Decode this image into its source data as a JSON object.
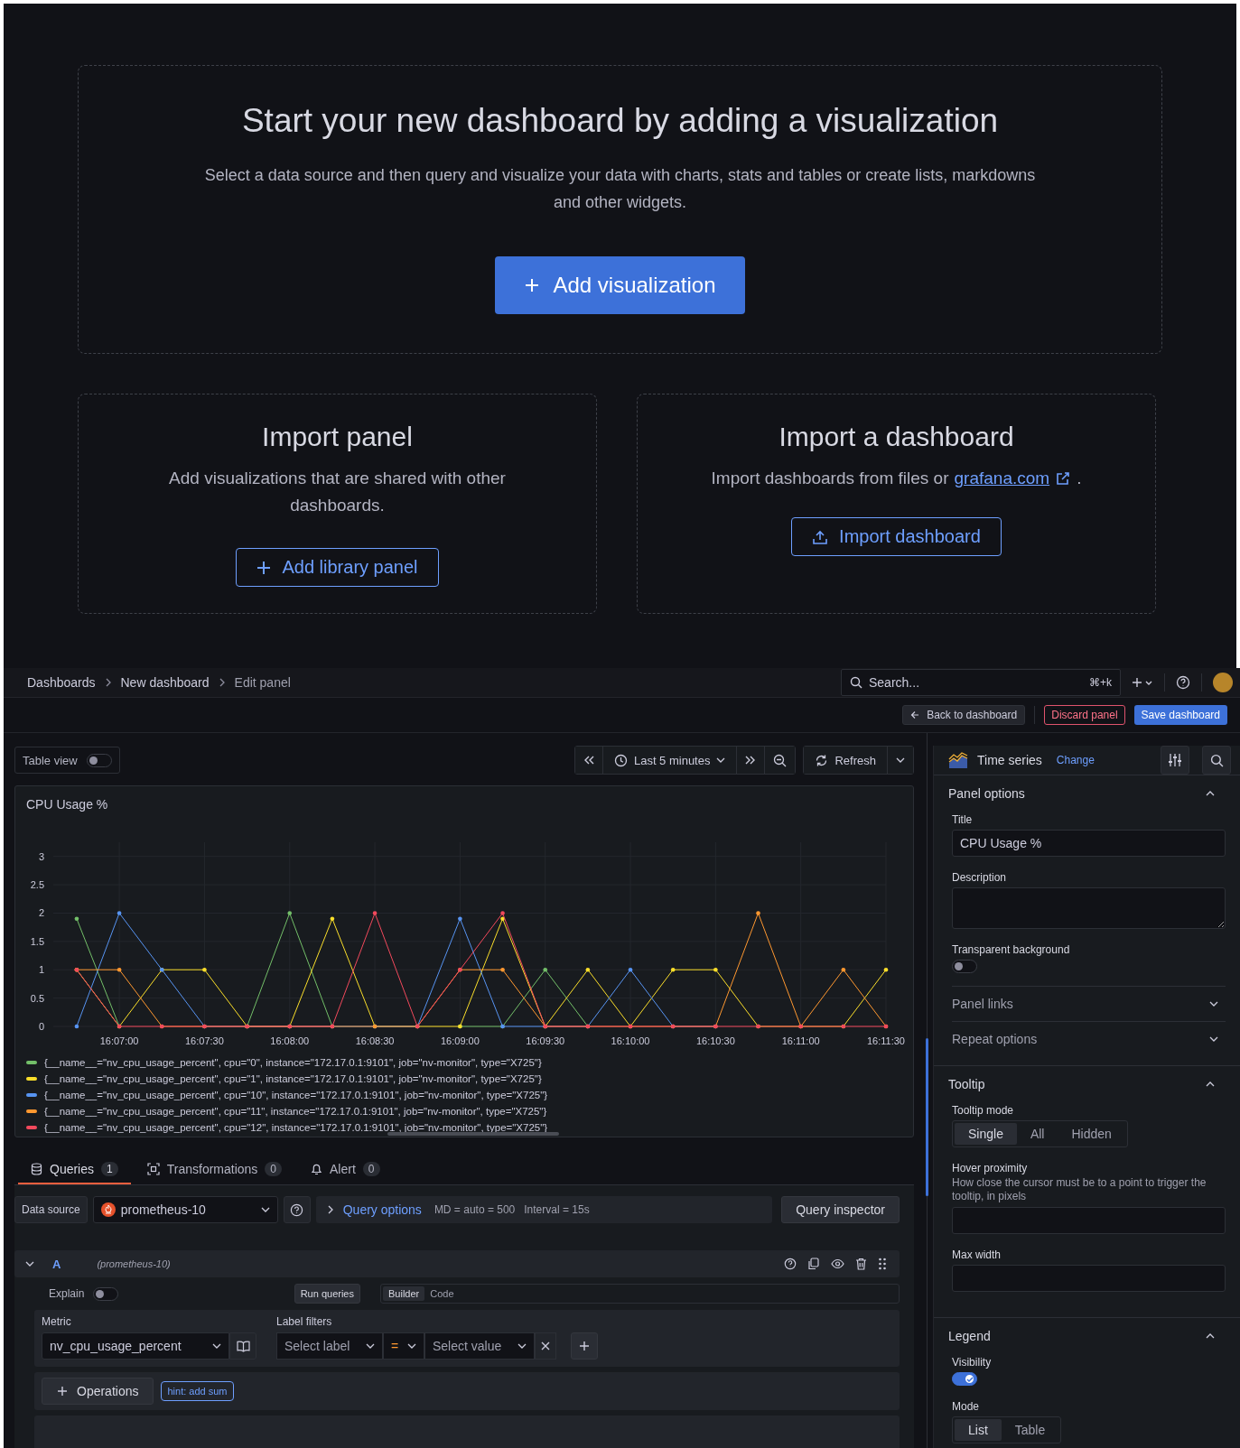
{
  "empty_state": {
    "title": "Start your new dashboard by adding a visualization",
    "description": "Select a data source and then query and visualize your data with charts, stats and tables or create lists, markdowns and other widgets.",
    "button": "Add visualization"
  },
  "import_panel": {
    "title": "Import panel",
    "description": "Add visualizations that are shared with other dashboards.",
    "button": "Add library panel"
  },
  "import_dashboard": {
    "title": "Import a dashboard",
    "description": "Import dashboards from files or",
    "link": "grafana.com",
    "description_end": ".",
    "button": "Import dashboard"
  },
  "top_bar": {
    "breadcrumbs": [
      "Dashboards",
      "New dashboard",
      "Edit panel"
    ],
    "search": {
      "placeholder": "Search...",
      "shortcut": "⌘+k"
    }
  },
  "actions": {
    "back": "Back to dashboard",
    "discard": "Discard panel",
    "save": "Save dashboard"
  },
  "panel_toolbar": {
    "table_view": {
      "label": "Table view",
      "on": false
    },
    "time_range": "Last 5 minutes",
    "refresh": "Refresh"
  },
  "panel": {
    "title": "CPU Usage %",
    "chart_data": {
      "type": "line",
      "categories": [
        null,
        "16:07:00",
        null,
        "16:07:30",
        null,
        "16:08:00",
        null,
        "16:08:30",
        null,
        "16:09:00",
        null,
        "16:09:30",
        null,
        "16:10:00",
        null,
        "16:10:30",
        null,
        "16:11:00",
        null,
        "16:11:30"
      ],
      "ylim": [
        0,
        3.25
      ],
      "grid": true,
      "yticks": [
        0,
        0.5,
        1,
        1.5,
        2,
        2.5,
        3
      ],
      "series": [
        {
          "name": "{__name__=\"nv_cpu_usage_percent\", cpu=\"0\", instance=\"172.17.0.1:9101\", job=\"nv-monitor\", type=\"X725\"}",
          "color": "#73bf69",
          "values": [
            1.9,
            0,
            null,
            null,
            0,
            2,
            0,
            null,
            null,
            0,
            0,
            1,
            0,
            null,
            null,
            null,
            null,
            null,
            null,
            null
          ]
        },
        {
          "name": "{__name__=\"nv_cpu_usage_percent\", cpu=\"1\", instance=\"172.17.0.1:9101\", job=\"nv-monitor\", type=\"X725\"}",
          "color": "#fade2a",
          "values": [
            1,
            0,
            1,
            1,
            0,
            0,
            1.9,
            0,
            0,
            0,
            1.9,
            0,
            1,
            0,
            1,
            1,
            0,
            0,
            0,
            1
          ]
        },
        {
          "name": "{__name__=\"nv_cpu_usage_percent\", cpu=\"10\", instance=\"172.17.0.1:9101\", job=\"nv-monitor\", type=\"X725\"}",
          "color": "#5794f2",
          "values": [
            0,
            2,
            1,
            0,
            0,
            0,
            0,
            0,
            0,
            1.9,
            0,
            0,
            0,
            1,
            0,
            0,
            null,
            null,
            null,
            null
          ]
        },
        {
          "name": "{__name__=\"nv_cpu_usage_percent\", cpu=\"11\", instance=\"172.17.0.1:9101\", job=\"nv-monitor\", type=\"X725\"}",
          "color": "#ff9830",
          "values": [
            1,
            1,
            0,
            0,
            0,
            0,
            0,
            0,
            0,
            1,
            1,
            0,
            0,
            0,
            0,
            0,
            2,
            0,
            1,
            0
          ]
        },
        {
          "name": "{__name__=\"nv_cpu_usage_percent\", cpu=\"12\", instance=\"172.17.0.1:9101\", job=\"nv-monitor\", type=\"X725\"}",
          "color": "#f2495c",
          "values": [
            1,
            0,
            0,
            0,
            0,
            0,
            0,
            2,
            0,
            1,
            2,
            0,
            0,
            0,
            0,
            0,
            0,
            0,
            0,
            0
          ]
        }
      ]
    }
  },
  "tabs": [
    {
      "label": "Queries",
      "count": "1",
      "selected": true
    },
    {
      "label": "Transformations",
      "count": "0",
      "selected": false
    },
    {
      "label": "Alert",
      "count": "0",
      "selected": false
    }
  ],
  "query_bar": {
    "data_source_label": "Data source",
    "data_source": "prometheus-10",
    "query_options": "Query options",
    "md": "MD = auto = 500",
    "interval": "Interval = 15s",
    "inspector": "Query inspector"
  },
  "query": {
    "ref": "A",
    "source": "(prometheus-10)",
    "explain": {
      "label": "Explain",
      "on": false
    },
    "run": "Run queries",
    "modes": [
      {
        "label": "Builder",
        "selected": true
      },
      {
        "label": "Code",
        "selected": false
      }
    ],
    "metric_label": "Metric",
    "metric": "nv_cpu_usage_percent",
    "label_filters_label": "Label filters",
    "label_placeholder": "Select label",
    "operator": "=",
    "value_placeholder": "Select value",
    "operations": "Operations",
    "hint": "hint: add sum"
  },
  "options": {
    "visualization": "Time series",
    "change": "Change",
    "panel_options": {
      "heading": "Panel options",
      "expanded": true,
      "title_label": "Title",
      "title_value": "CPU Usage %",
      "description_label": "Description",
      "transparent_label": "Transparent background",
      "transparent": false
    },
    "collapsed_sections": [
      {
        "heading": "Panel links",
        "expanded": false
      },
      {
        "heading": "Repeat options",
        "expanded": false
      }
    ],
    "tooltip": {
      "heading": "Tooltip",
      "expanded": true,
      "mode_label": "Tooltip mode",
      "modes": [
        {
          "label": "Single",
          "selected": true
        },
        {
          "label": "All",
          "selected": false
        },
        {
          "label": "Hidden",
          "selected": false
        }
      ],
      "hover_label": "Hover proximity",
      "hover_help": "How close the cursor must be to a point to trigger the tooltip, in pixels",
      "max_width_label": "Max width"
    },
    "legend": {
      "heading": "Legend",
      "expanded": true,
      "visibility_label": "Visibility",
      "visibility": true,
      "mode_label": "Mode",
      "modes": [
        {
          "label": "List",
          "selected": true
        },
        {
          "label": "Table",
          "selected": false
        }
      ]
    }
  }
}
